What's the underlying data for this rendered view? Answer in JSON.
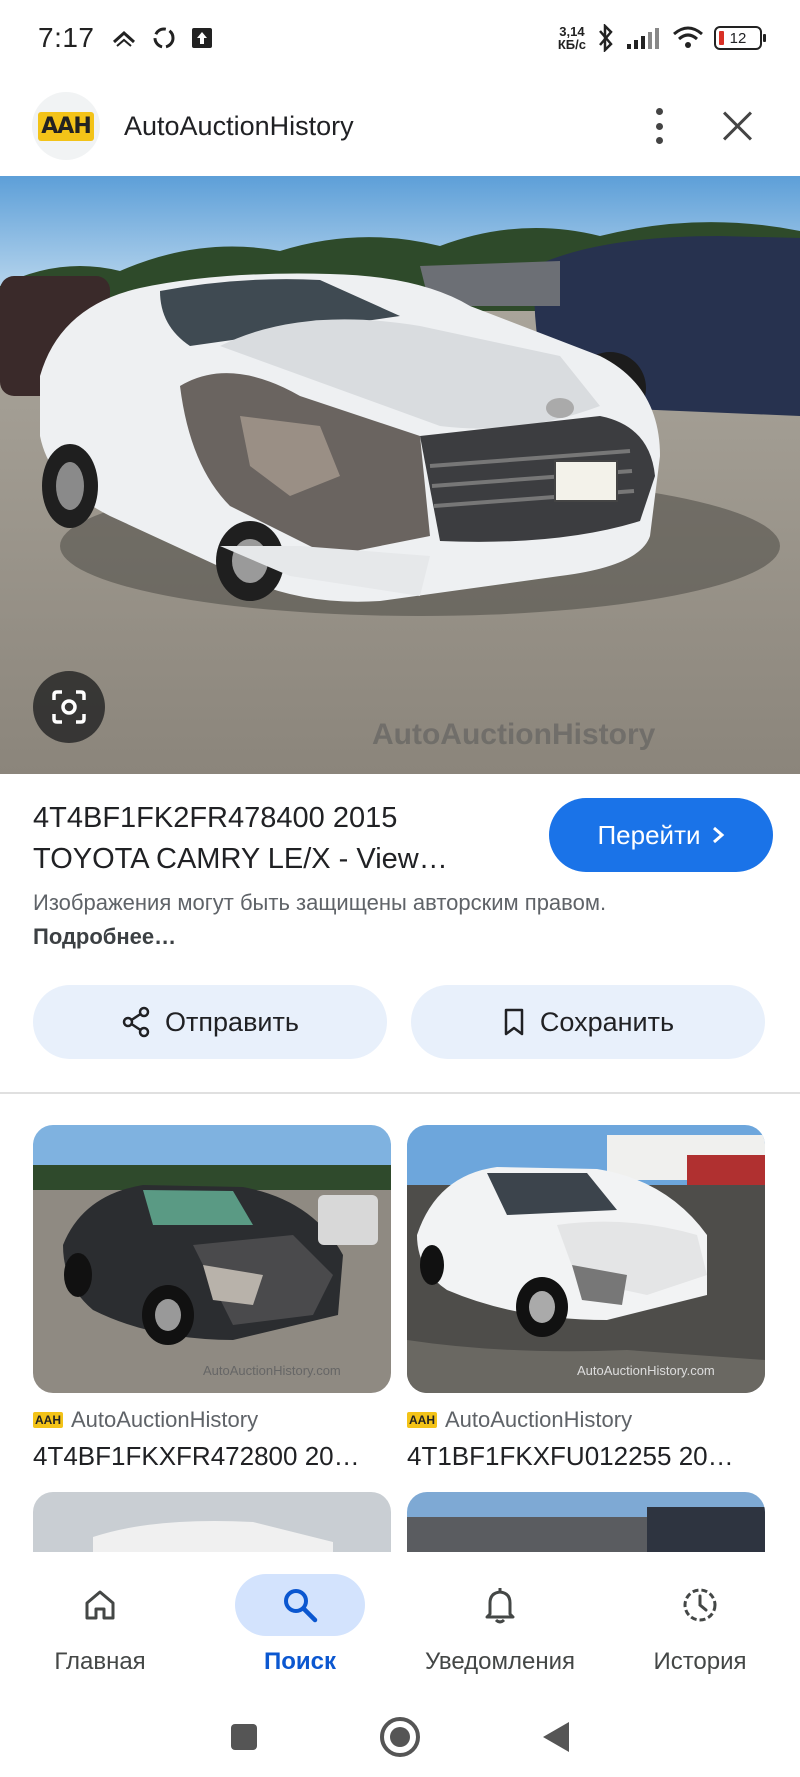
{
  "status_bar": {
    "time": "7:17",
    "net_speed_value": "3,14",
    "net_speed_unit": "КБ/с",
    "battery": "12"
  },
  "header": {
    "logo_text": "AAH",
    "site_name": "AutoAuctionHistory"
  },
  "main_result": {
    "title": "4T4BF1FK2FR478400 2015 TOYOTA CAMRY LE/X - View…",
    "go_button_label": "Перейти",
    "copyright_text": "Изображения могут быть защищены авторским правом.",
    "copyright_link": "Подробнее…",
    "watermark_text": "AutoAuctionHistory"
  },
  "actions": {
    "share_label": "Отправить",
    "save_label": "Сохранить"
  },
  "related": [
    {
      "source": "AutoAuctionHistory",
      "title": "4T4BF1FKXFR472800 20…"
    },
    {
      "source": "AutoAuctionHistory",
      "title": "4T1BF1FKXFU012255 20…"
    }
  ],
  "bottom_nav": {
    "items": [
      {
        "label": "Главная",
        "icon": "home-icon"
      },
      {
        "label": "Поиск",
        "icon": "search-icon",
        "active": true
      },
      {
        "label": "Уведомления",
        "icon": "bell-icon"
      },
      {
        "label": "История",
        "icon": "history-icon"
      }
    ]
  },
  "colors": {
    "primary": "#1a73e8",
    "active_nav": "#0b57d0",
    "chip_bg": "#e8f0fb"
  }
}
